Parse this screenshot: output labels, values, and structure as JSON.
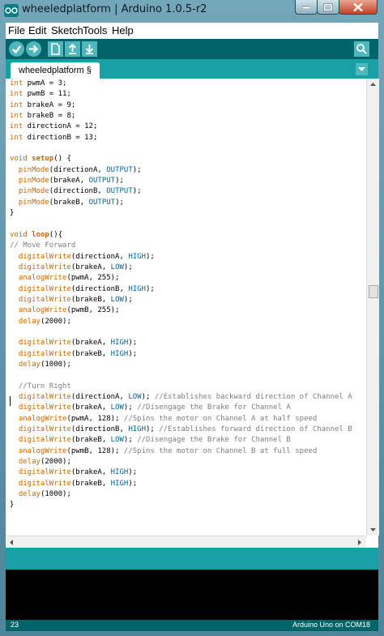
{
  "window": {
    "title": "wheeledplatform | Arduino 1.0.5-r2"
  },
  "menu": {
    "items": [
      {
        "label": "File"
      },
      {
        "label": "Edit"
      },
      {
        "label": "Sketch"
      },
      {
        "label": "Tools"
      },
      {
        "label": "Help"
      }
    ]
  },
  "toolbar": {
    "buttons": [
      {
        "name": "verify-icon"
      },
      {
        "name": "upload-icon"
      },
      {
        "name": "new-icon"
      },
      {
        "name": "open-icon"
      },
      {
        "name": "save-icon"
      },
      {
        "name": "serial-monitor-icon"
      }
    ]
  },
  "tab": {
    "label": "wheeledplatform §"
  },
  "code": {
    "lines": [
      "int pwmA = 3;",
      "int pwmB = 11;",
      "int brakeA = 9;",
      "int brakeB = 8;",
      "int directionA = 12;",
      "int directionB = 13;",
      "",
      "void setup() {",
      "  pinMode(directionA, OUTPUT);",
      "  pinMode(brakeA, OUTPUT);",
      "  pinMode(directionB, OUTPUT);",
      "  pinMode(brakeB, OUTPUT);",
      "}",
      "",
      "void loop(){",
      "// Move Forward",
      "  digitalWrite(directionA, HIGH);",
      "  digitalWrite(brakeA, LOW);",
      "  analogWrite(pwmA, 255);",
      "  digitalWrite(directionB, HIGH);",
      "  digitalWrite(brakeB, LOW);",
      "  analogWrite(pwmB, 255);",
      "  delay(2000);",
      "",
      "  digitalWrite(brakeA, HIGH);",
      "  digitalWrite(brakeB, HIGH);",
      "  delay(1000);",
      "",
      "  //Turn Right",
      "  digitalWrite(directionA, LOW); //Establishes backward direction of Channel A",
      "  digitalWrite(brakeA, LOW); //Disengage the Brake for Channel A",
      "  analogWrite(pwmA, 128); //Spins the motor on Channel A at half speed",
      "  digitalWrite(directionB, HIGH); //Establishes forward direction of Channel B",
      "  digitalWrite(brakeB, LOW); //Disengage the Brake for Channel B",
      "  analogWrite(pwmB, 128); //Spins the motor on Channel B at full speed",
      "  delay(2000);",
      "  digitalWrite(brakeA, HIGH);",
      "  digitalWrite(brakeB, HIGH);",
      "  delay(1000);",
      "}"
    ]
  },
  "status": {
    "line_number": "23",
    "board": "Arduino Uno on COM18"
  },
  "colors": {
    "toolbar": "#006468",
    "tabstrip": "#17a1a5",
    "keyword": "#cc6600",
    "constant": "#006699",
    "comment": "#7e7e7e"
  }
}
